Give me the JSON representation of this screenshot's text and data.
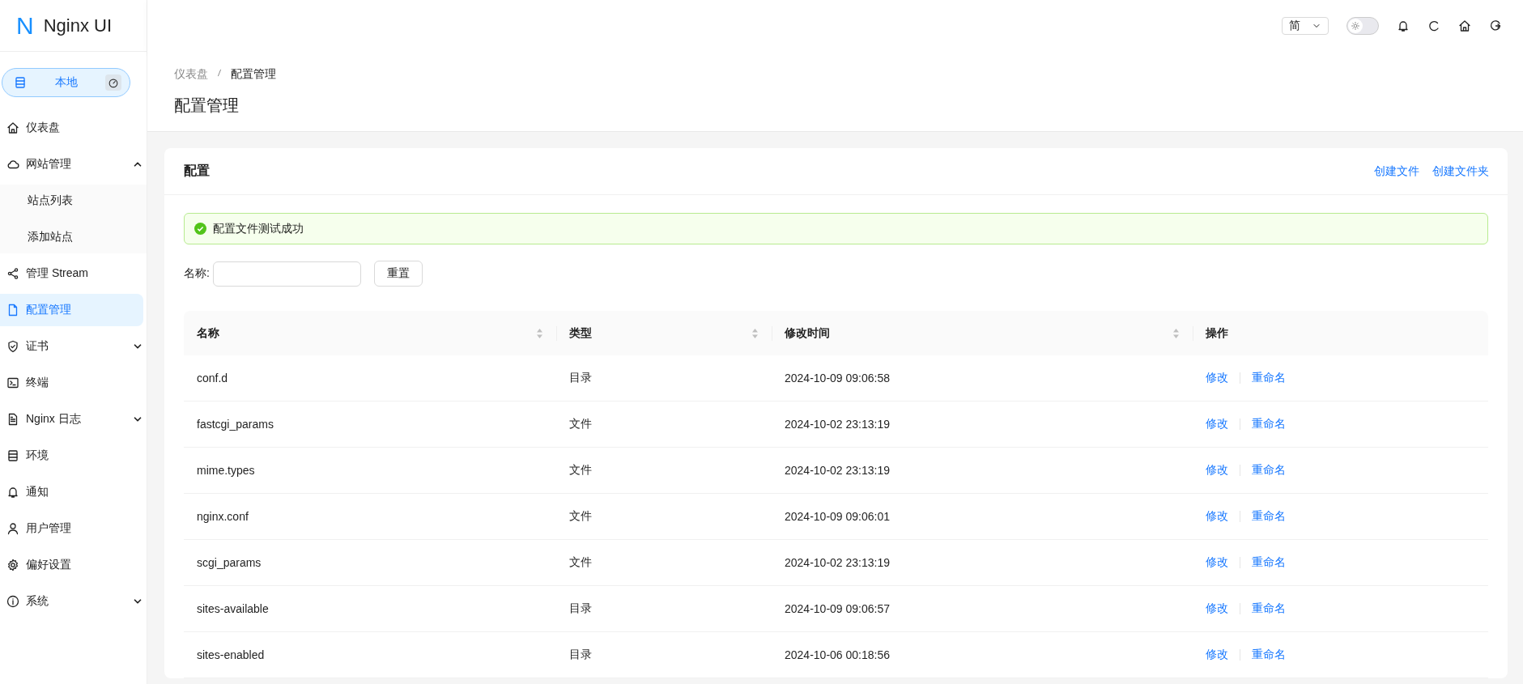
{
  "brand": {
    "letter": "N",
    "name": "Nginx UI"
  },
  "environment": {
    "label": "本地"
  },
  "sidebar": {
    "items": [
      {
        "label": "仪表盘",
        "selected": false
      },
      {
        "label": "网站管理",
        "selected": false,
        "expanded": true,
        "children": [
          {
            "label": "站点列表",
            "selected": false
          },
          {
            "label": "添加站点",
            "selected": false
          }
        ]
      },
      {
        "label": "管理 Stream",
        "selected": false
      },
      {
        "label": "配置管理",
        "selected": true
      },
      {
        "label": "证书",
        "selected": false,
        "expanded": false
      },
      {
        "label": "终端",
        "selected": false
      },
      {
        "label": "Nginx 日志",
        "selected": false,
        "expanded": false
      },
      {
        "label": "环境",
        "selected": false
      },
      {
        "label": "通知",
        "selected": false
      },
      {
        "label": "用户管理",
        "selected": false
      },
      {
        "label": "偏好设置",
        "selected": false
      },
      {
        "label": "系统",
        "selected": false,
        "expanded": false
      }
    ]
  },
  "topbar": {
    "language": "简",
    "dark_mode": false
  },
  "breadcrumb": [
    "仪表盘",
    "配置管理"
  ],
  "page_title": "配置管理",
  "card": {
    "title": "配置",
    "actions": [
      "创建文件",
      "创建文件夹"
    ],
    "alert": {
      "text": "配置文件测试成功"
    },
    "filter": {
      "label": "名称:",
      "reset": "重置"
    },
    "table": {
      "columns": [
        {
          "label": "名称",
          "sortable": true
        },
        {
          "label": "类型",
          "sortable": true
        },
        {
          "label": "修改时间",
          "sortable": true
        },
        {
          "label": "操作",
          "sortable": false
        }
      ],
      "rows": [
        {
          "name": "conf.d",
          "type": "目录",
          "modified": "2024-10-09 09:06:58",
          "actions": [
            "修改",
            "重命名"
          ]
        },
        {
          "name": "fastcgi_params",
          "type": "文件",
          "modified": "2024-10-02 23:13:19",
          "actions": [
            "修改",
            "重命名"
          ]
        },
        {
          "name": "mime.types",
          "type": "文件",
          "modified": "2024-10-02 23:13:19",
          "actions": [
            "修改",
            "重命名"
          ]
        },
        {
          "name": "nginx.conf",
          "type": "文件",
          "modified": "2024-10-09 09:06:01",
          "actions": [
            "修改",
            "重命名"
          ]
        },
        {
          "name": "scgi_params",
          "type": "文件",
          "modified": "2024-10-02 23:13:19",
          "actions": [
            "修改",
            "重命名"
          ]
        },
        {
          "name": "sites-available",
          "type": "目录",
          "modified": "2024-10-09 09:06:57",
          "actions": [
            "修改",
            "重命名"
          ]
        },
        {
          "name": "sites-enabled",
          "type": "目录",
          "modified": "2024-10-06 00:18:56",
          "actions": [
            "修改",
            "重命名"
          ]
        }
      ]
    }
  }
}
